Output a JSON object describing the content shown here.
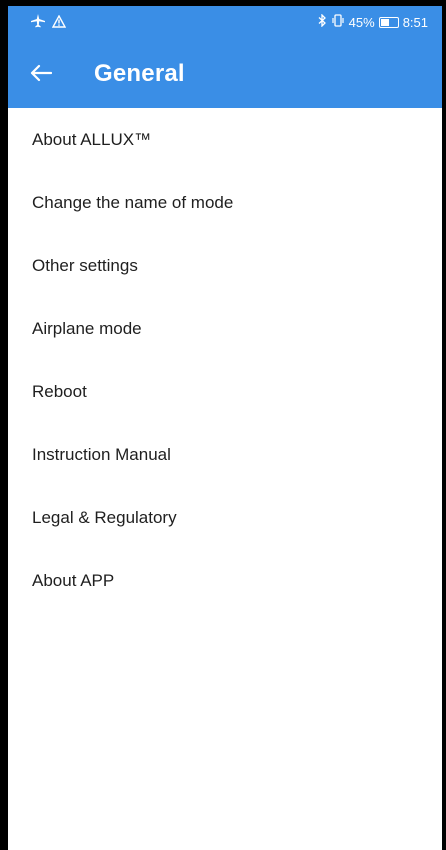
{
  "status_bar": {
    "airplane_icon": "airplane-icon",
    "warning_icon": "warning-icon",
    "bluetooth_icon": "bluetooth-icon",
    "vibrate_icon": "vibrate-icon",
    "battery_percent": "45%",
    "time": "8:51",
    "color": "#3a8ee6"
  },
  "header": {
    "title": "General",
    "back_icon": "arrow-left-icon"
  },
  "menu": {
    "items": [
      {
        "label": "About ALLUX™"
      },
      {
        "label": "Change the name of mode"
      },
      {
        "label": "Other settings"
      },
      {
        "label": "Airplane mode"
      },
      {
        "label": "Reboot"
      },
      {
        "label": "Instruction Manual"
      },
      {
        "label": "Legal & Regulatory"
      },
      {
        "label": "About APP"
      }
    ]
  }
}
